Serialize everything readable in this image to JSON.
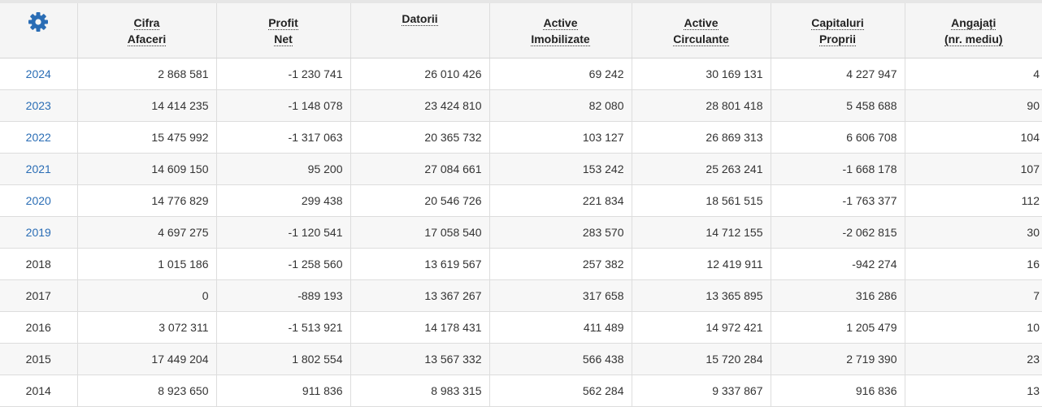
{
  "settings_icon": "gear-icon",
  "accent_color": "#2a6db5",
  "columns": [
    {
      "line1": "Cifra",
      "line2": "Afaceri"
    },
    {
      "line1": "Profit",
      "line2": "Net"
    },
    {
      "line1": "Datorii",
      "line2": ""
    },
    {
      "line1": "Active",
      "line2": "Imobilizate"
    },
    {
      "line1": "Active",
      "line2": "Circulante"
    },
    {
      "line1": "Capitaluri",
      "line2": "Proprii"
    },
    {
      "line1": "Angajați",
      "line2": "(nr. mediu)"
    }
  ],
  "rows": [
    {
      "year": "2024",
      "linked": true,
      "values": [
        "2 868 581",
        "-1 230 741",
        "26 010 426",
        "69 242",
        "30 169 131",
        "4 227 947",
        "4"
      ]
    },
    {
      "year": "2023",
      "linked": true,
      "values": [
        "14 414 235",
        "-1 148 078",
        "23 424 810",
        "82 080",
        "28 801 418",
        "5 458 688",
        "90"
      ]
    },
    {
      "year": "2022",
      "linked": true,
      "values": [
        "15 475 992",
        "-1 317 063",
        "20 365 732",
        "103 127",
        "26 869 313",
        "6 606 708",
        "104"
      ]
    },
    {
      "year": "2021",
      "linked": true,
      "values": [
        "14 609 150",
        "95 200",
        "27 084 661",
        "153 242",
        "25 263 241",
        "-1 668 178",
        "107"
      ]
    },
    {
      "year": "2020",
      "linked": true,
      "values": [
        "14 776 829",
        "299 438",
        "20 546 726",
        "221 834",
        "18 561 515",
        "-1 763 377",
        "112"
      ]
    },
    {
      "year": "2019",
      "linked": true,
      "values": [
        "4 697 275",
        "-1 120 541",
        "17 058 540",
        "283 570",
        "14 712 155",
        "-2 062 815",
        "30"
      ]
    },
    {
      "year": "2018",
      "linked": false,
      "values": [
        "1 015 186",
        "-1 258 560",
        "13 619 567",
        "257 382",
        "12 419 911",
        "-942 274",
        "16"
      ]
    },
    {
      "year": "2017",
      "linked": false,
      "values": [
        "0",
        "-889 193",
        "13 367 267",
        "317 658",
        "13 365 895",
        "316 286",
        "7"
      ]
    },
    {
      "year": "2016",
      "linked": false,
      "values": [
        "3 072 311",
        "-1 513 921",
        "14 178 431",
        "411 489",
        "14 972 421",
        "1 205 479",
        "10"
      ]
    },
    {
      "year": "2015",
      "linked": false,
      "values": [
        "17 449 204",
        "1 802 554",
        "13 567 332",
        "566 438",
        "15 720 284",
        "2 719 390",
        "23"
      ]
    },
    {
      "year": "2014",
      "linked": false,
      "values": [
        "8 923 650",
        "911 836",
        "8 983 315",
        "562 284",
        "9 337 867",
        "916 836",
        "13"
      ]
    }
  ]
}
